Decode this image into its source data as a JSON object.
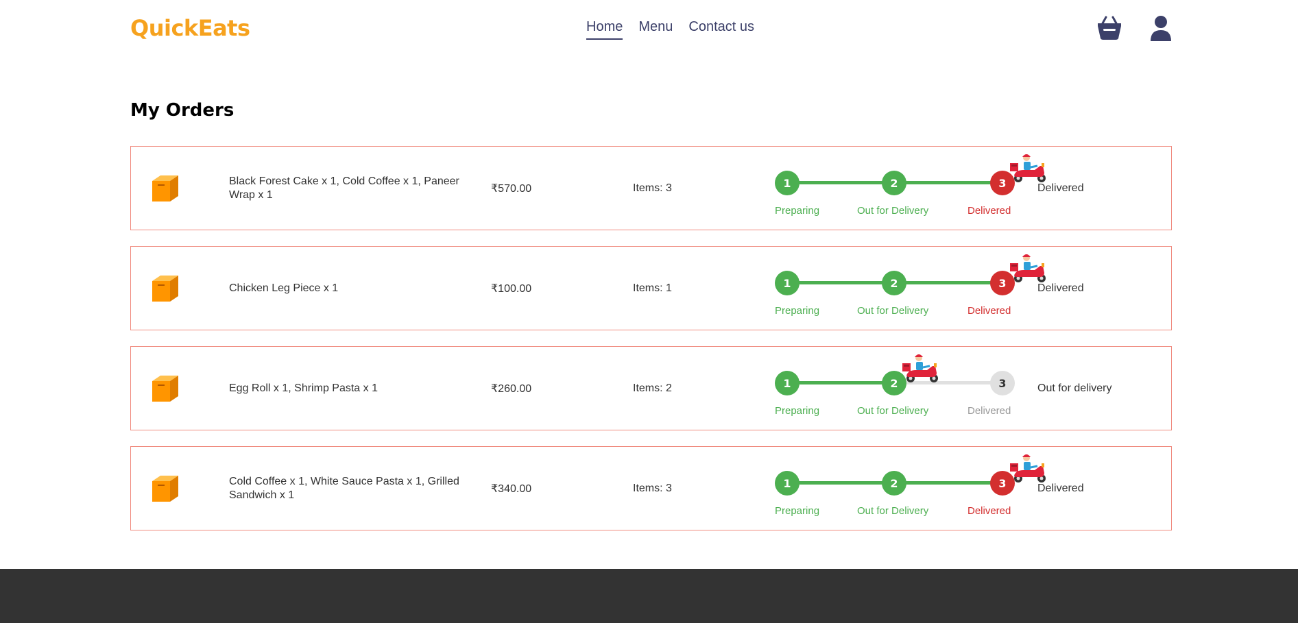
{
  "brand": {
    "name": "QuickEats",
    "color": "#f6a21e"
  },
  "nav": {
    "links": [
      {
        "label": "Home",
        "active": true
      },
      {
        "label": "Menu",
        "active": false
      },
      {
        "label": "Contact us",
        "active": false
      }
    ],
    "icons": [
      "cart-icon",
      "user-icon"
    ]
  },
  "page": {
    "title": "My Orders"
  },
  "steps": {
    "labels": [
      "Preparing",
      "Out for Delivery",
      "Delivered"
    ],
    "numbers": [
      "1",
      "2",
      "3"
    ]
  },
  "orders": [
    {
      "items": "Black Forest Cake x 1, Cold Coffee x 1, Paneer Wrap x 1",
      "price": "₹570.00",
      "count": "Items: 3",
      "status": "Delivered",
      "stage": 3
    },
    {
      "items": "Chicken Leg Piece x 1",
      "price": "₹100.00",
      "count": "Items: 1",
      "status": "Delivered",
      "stage": 3
    },
    {
      "items": "Egg Roll x 1, Shrimp Pasta x 1",
      "price": "₹260.00",
      "count": "Items: 2",
      "status": "Out for delivery",
      "stage": 2
    },
    {
      "items": "Cold Coffee x 1, White Sauce Pasta x 1, Grilled Sandwich x 1",
      "price": "₹340.00",
      "count": "Items: 3",
      "status": "Delivered",
      "stage": 3
    }
  ],
  "colors": {
    "done": "#4caf50",
    "delivered": "#d32f2f",
    "pending": "#e0e0e0",
    "border": "#f08a7e",
    "footer": "#333333"
  }
}
